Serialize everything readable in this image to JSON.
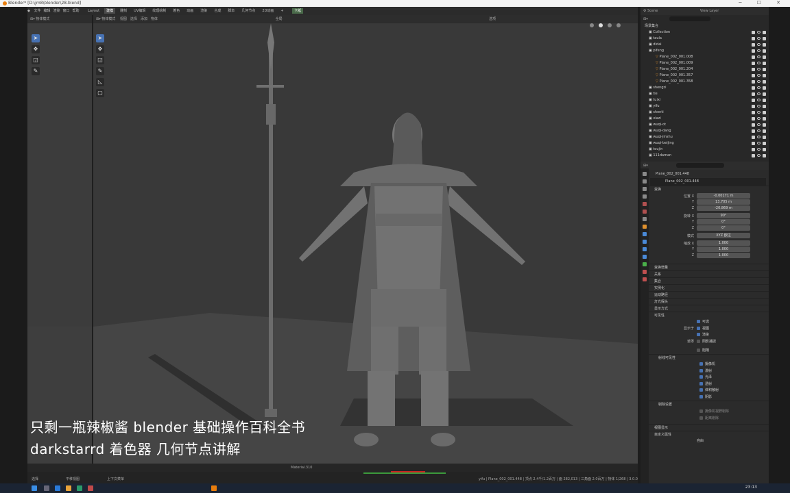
{
  "window": {
    "title": "Blender* [D:\\jm8\\blender\\28.blend]",
    "menu_left": [
      "文件",
      "编辑",
      "渲染",
      "窗口",
      "帮助"
    ],
    "workspace_tabs": [
      "Layout",
      "建模",
      "雕刻",
      "UV编辑",
      "纹理绘制",
      "着色",
      "动画",
      "渲染",
      "合成",
      "脚本",
      "几何节点",
      "2D动画",
      "+"
    ],
    "active_tab": "建模",
    "workspace_label": "卡纸",
    "scene_label": "Scene",
    "viewlayer_label": "View Layer"
  },
  "viewport": {
    "mode_label": "物体模式",
    "menus": [
      "视图",
      "选择",
      "添加",
      "物体"
    ],
    "global_label": "全局",
    "options_label": "选项"
  },
  "subtitle": {
    "line1": "只剩一瓶辣椒酱   blender 基础操作百科全书",
    "line2": "darkstarrd  着色器  几何节点讲解"
  },
  "outliner": {
    "header": "场景集合",
    "items": [
      {
        "name": "Collection",
        "indent": 0,
        "kind": "collection"
      },
      {
        "name": "taula",
        "indent": 0,
        "kind": "collection"
      },
      {
        "name": "didai",
        "indent": 0,
        "kind": "collection"
      },
      {
        "name": "pifeng",
        "indent": 0,
        "kind": "collection"
      },
      {
        "name": "Plane_002_001.008",
        "indent": 1,
        "kind": "mesh"
      },
      {
        "name": "Plane_002_001.009",
        "indent": 1,
        "kind": "mesh"
      },
      {
        "name": "Plane_002_001.204",
        "indent": 1,
        "kind": "mesh"
      },
      {
        "name": "Plane_002_001.357",
        "indent": 1,
        "kind": "mesh"
      },
      {
        "name": "Plane_002_001.358",
        "indent": 1,
        "kind": "mesh"
      },
      {
        "name": "shengzi",
        "indent": 0,
        "kind": "collection"
      },
      {
        "name": "tie",
        "indent": 0,
        "kind": "collection"
      },
      {
        "name": "tuixi",
        "indent": 0,
        "kind": "collection"
      },
      {
        "name": "yifu",
        "indent": 0,
        "kind": "collection"
      },
      {
        "name": "shenti",
        "indent": 0,
        "kind": "collection"
      },
      {
        "name": "xiazi",
        "indent": 0,
        "kind": "collection"
      },
      {
        "name": "wuqi-ot",
        "indent": 0,
        "kind": "collection"
      },
      {
        "name": "wuqi-dang",
        "indent": 0,
        "kind": "collection"
      },
      {
        "name": "wuqi-jinshu",
        "indent": 0,
        "kind": "collection"
      },
      {
        "name": "wuqi-beijing",
        "indent": 0,
        "kind": "collection"
      },
      {
        "name": "toujin",
        "indent": 0,
        "kind": "collection"
      },
      {
        "name": "111daman",
        "indent": 0,
        "kind": "collection"
      }
    ]
  },
  "properties": {
    "object_name": "Plane_002_001.448",
    "data_name": "Plane_002_001.448",
    "transform_label": "变换",
    "location_label": "位置 X",
    "location": [
      "-0.00171 m",
      "13.705 m",
      "-20.869 m"
    ],
    "rotation_label": "旋转 X",
    "rotation": [
      "90°",
      "0°",
      "0°"
    ],
    "mode_label": "模式",
    "rotation_mode": "XYZ 欧拉",
    "scale_label": "缩放 X",
    "scale": [
      "1.000",
      "1.000",
      "1.000"
    ],
    "axis_y": "Y",
    "axis_z": "Z",
    "sections_a": [
      "变换增量",
      "关系",
      "集合",
      "实例化",
      "运动路径",
      "灯光探头",
      "显示方式"
    ],
    "visibility_label": "可见性",
    "selectable": "可选",
    "show_in_label": "显示于",
    "viewports": "视图",
    "renders": "渲染",
    "mask_label": "遮罩",
    "shadow_catcher": "阴影捕捉",
    "holdout": "阻隔",
    "ray_visibility_label": "射线可见性",
    "ray_items": [
      "摄像机",
      "漫射",
      "光泽",
      "透射",
      "体积散射",
      "阴影"
    ],
    "culling_label": "剔除设置",
    "culling_items": [
      "摄像机视野剔除",
      "距离剔除"
    ],
    "sections_b": [
      "视图显示",
      "自定义属性"
    ],
    "last_label": "自由"
  },
  "statusbar": {
    "left_items": [
      "选择",
      "平移视图",
      "上下文菜单"
    ],
    "material_label": "Material.310",
    "right_info": "yifu | Plane_002_001.448 | 顶点 2.4千/1.2百万 | 面 282,013 | 三角面 2.0百万 | 物体 1/268 | 3.0.0",
    "time": "23:13"
  }
}
